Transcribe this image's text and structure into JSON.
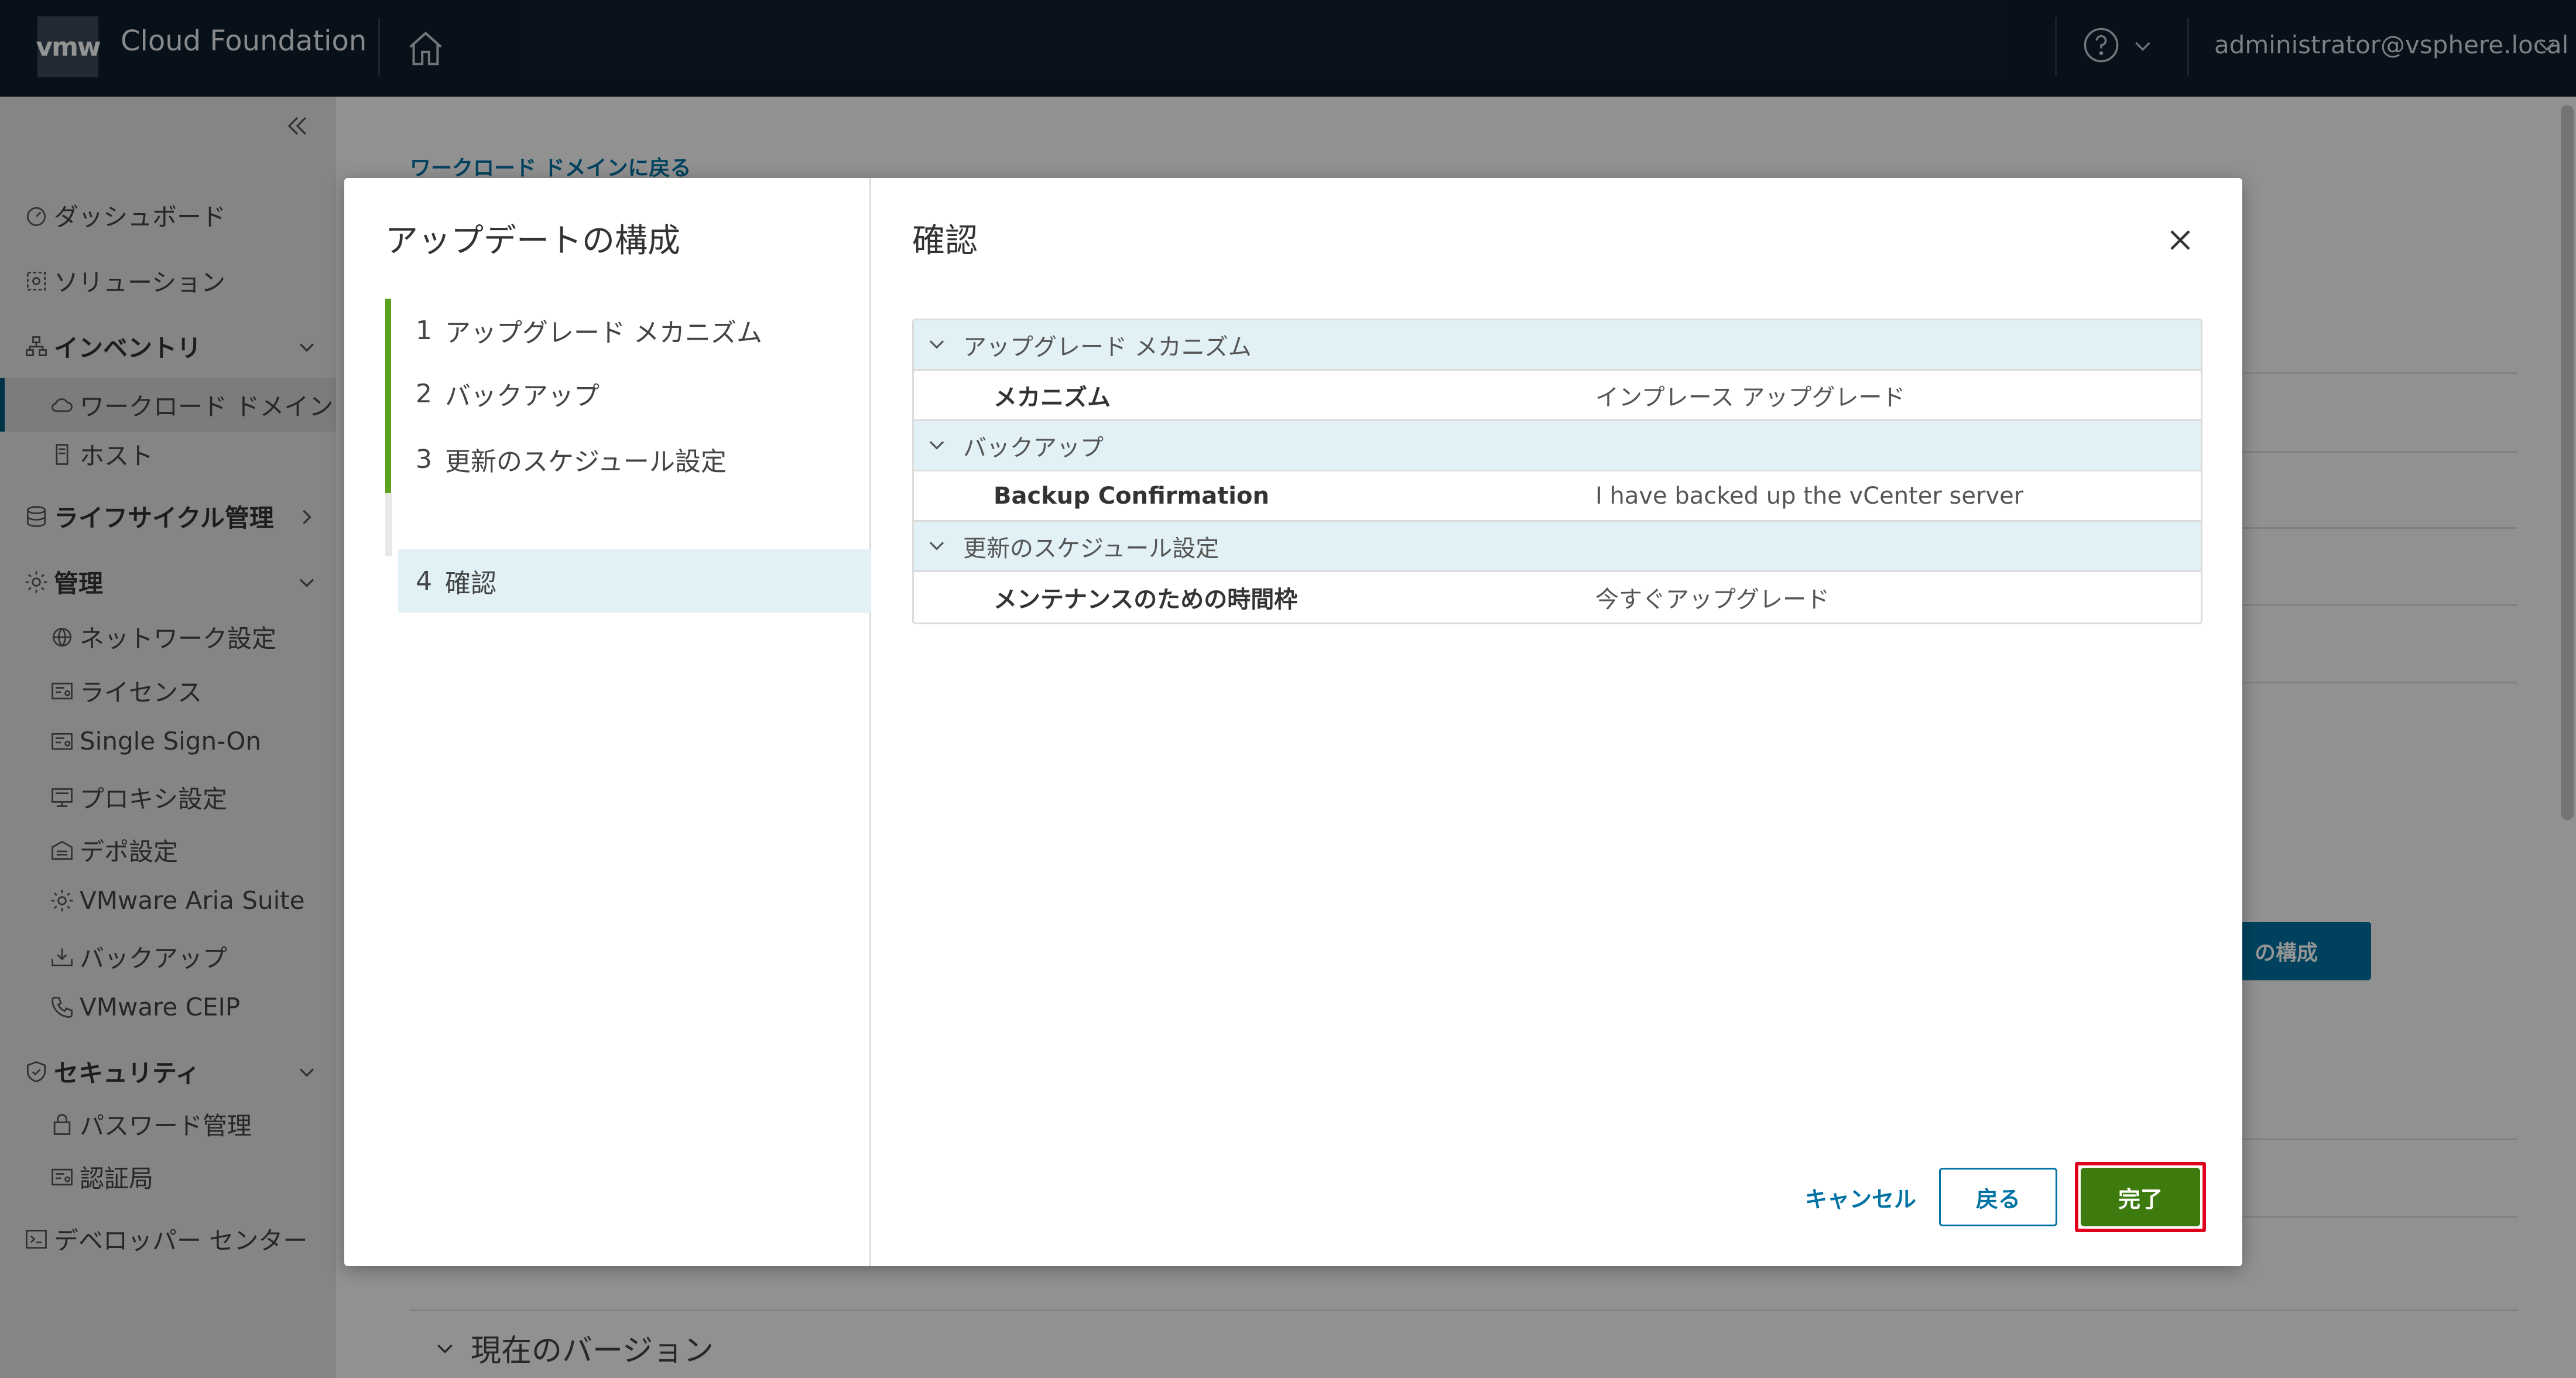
{
  "header": {
    "logo": "vmw",
    "app_title": "Cloud Foundation",
    "user": "administrator@vsphere.local"
  },
  "sidebar": {
    "items": [
      {
        "label": "ダッシュボード"
      },
      {
        "label": "ソリューション"
      },
      {
        "label": "インベントリ"
      },
      {
        "label": "ワークロード ドメイン"
      },
      {
        "label": "ホスト"
      },
      {
        "label": "ライフサイクル管理"
      },
      {
        "label": "管理"
      },
      {
        "label": "ネットワーク設定"
      },
      {
        "label": "ライセンス"
      },
      {
        "label": "Single Sign-On"
      },
      {
        "label": "プロキシ設定"
      },
      {
        "label": "デポ設定"
      },
      {
        "label": "VMware Aria Suite"
      },
      {
        "label": "バックアップ"
      },
      {
        "label": "VMware CEIP"
      },
      {
        "label": "セキュリティ"
      },
      {
        "label": "パスワード管理"
      },
      {
        "label": "認証局"
      },
      {
        "label": "デベロッパー センター"
      }
    ]
  },
  "background": {
    "back_link": "ワークロード ドメインに戻る",
    "blue_button": "の構成",
    "current_version": "現在のバージョン"
  },
  "wizard": {
    "title": "アップデートの構成",
    "steps": [
      {
        "num": "1",
        "label": "アップグレード メカニズム"
      },
      {
        "num": "2",
        "label": "バックアップ"
      },
      {
        "num": "3",
        "label": "更新のスケジュール設定"
      },
      {
        "num": "4",
        "label": "確認"
      }
    ],
    "content_title": "確認",
    "review": [
      {
        "section": "アップグレード メカニズム",
        "key": "メカニズム",
        "value": "インプレース アップグレード"
      },
      {
        "section": "バックアップ",
        "key": "Backup Confirmation",
        "value": "I have backed up the vCenter server"
      },
      {
        "section": "更新のスケジュール設定",
        "key": "メンテナンスのための時間枠",
        "value": "今すぐアップグレード"
      }
    ],
    "buttons": {
      "cancel": "キャンセル",
      "back": "戻る",
      "finish": "完了"
    }
  },
  "colors": {
    "header_bg": "#0f1e2e",
    "accent_blue": "#0072a3",
    "finish_green": "#3e7b0e",
    "step_done": "#5aa220",
    "highlight_red": "#e0001b"
  }
}
